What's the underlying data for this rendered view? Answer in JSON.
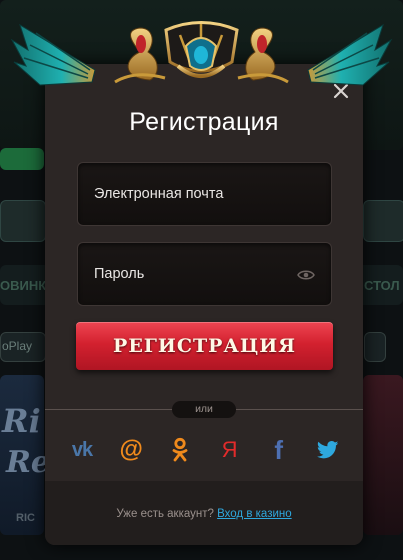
{
  "modal": {
    "title": "Регистрация",
    "email_placeholder": "Электронная почта",
    "password_placeholder": "Пароль",
    "register_button": "РЕГИСТРАЦИЯ",
    "or_label": "или",
    "have_account_text": "Уже есть аккаунт?",
    "login_link": "Вход в казино"
  },
  "social": [
    {
      "name": "vk",
      "label": "vk",
      "color": "#4a76a8"
    },
    {
      "name": "mail",
      "label": "@",
      "color": "#f08a1c"
    },
    {
      "name": "odnoklassniki",
      "label": "ok",
      "color": "#f08a1c"
    },
    {
      "name": "yandex",
      "label": "Я",
      "color": "#e22b2b"
    },
    {
      "name": "facebook",
      "label": "f",
      "color": "#4d6fb2"
    },
    {
      "name": "twitter",
      "label": "twitter",
      "color": "#2ea8de"
    }
  ],
  "background": {
    "tab_new": "ОВИНК",
    "tab_table": "СТОЛ",
    "provider": "oPlay",
    "game_word": "Ri",
    "game_word2": "Re",
    "game_caption": "RIC"
  },
  "colors": {
    "modal_bg": "#2c2625",
    "accent_red": "#d3212f",
    "link_blue": "#2ea8de"
  }
}
